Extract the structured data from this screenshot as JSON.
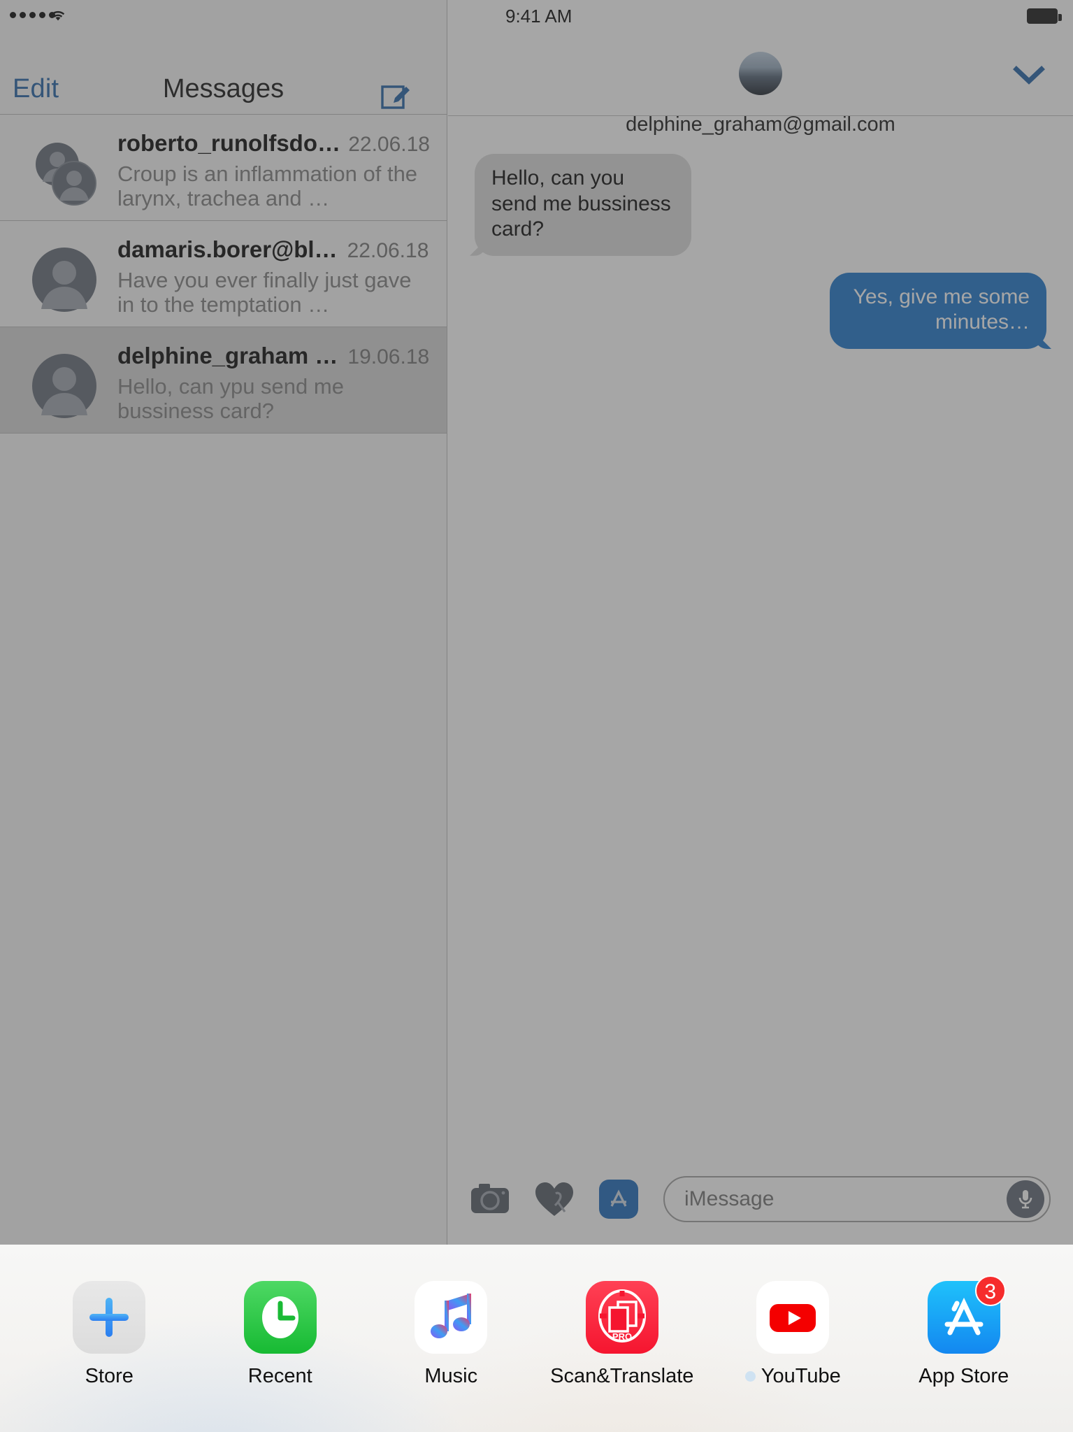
{
  "status_bar_left": {
    "signal_dots": 5,
    "wifi_icon": "wifi-icon"
  },
  "status_bar_right": {
    "time": "9:41 AM",
    "battery_icon": "battery-full-icon"
  },
  "messages_list": {
    "edit_label": "Edit",
    "title": "Messages",
    "compose_icon": "compose-icon",
    "conversations": [
      {
        "name": "roberto_runolfsdo…",
        "date": "22.06.18",
        "preview": "Croup is an inflammation of the larynx, trachea and …",
        "avatar": "group-avatar-icon",
        "selected": false
      },
      {
        "name": "damaris.borer@bl…",
        "date": "22.06.18",
        "preview": "Have you ever finally just gave in to the temptation …",
        "avatar": "person-avatar-icon",
        "selected": false
      },
      {
        "name": "delphine_graham …",
        "date": "19.06.18",
        "preview": "Hello, can ypu send me bussiness card?",
        "avatar": "person-avatar-icon",
        "selected": true
      }
    ]
  },
  "conversation": {
    "contact_email": "delphine_graham@gmail.com",
    "avatar": "contact-photo",
    "details_icon": "chevron-down-icon",
    "messages": [
      {
        "direction": "in",
        "text": "Hello, can you send me bussiness card?"
      },
      {
        "direction": "out",
        "text": "Yes, give me some minutes…"
      }
    ]
  },
  "composer": {
    "camera_icon": "camera-icon",
    "digital_touch_icon": "digital-touch-heart-icon",
    "app_store_icon": "imessage-appstore-icon",
    "input_value": "",
    "input_placeholder": "iMessage",
    "mic_icon": "microphone-icon"
  },
  "dock": {
    "apps": [
      {
        "label": "Store",
        "icon": "plus-icon",
        "badge": null,
        "dot": false
      },
      {
        "label": "Recent",
        "icon": "clock-icon",
        "badge": null,
        "dot": false
      },
      {
        "label": "Music",
        "icon": "music-note-icon",
        "badge": null,
        "dot": false
      },
      {
        "label": "Scan&Translate",
        "icon": "scan-pro-icon",
        "badge": null,
        "dot": false
      },
      {
        "label": "YouTube",
        "icon": "youtube-icon",
        "badge": null,
        "dot": true
      },
      {
        "label": "App Store",
        "icon": "app-store-icon",
        "badge": "3",
        "dot": false
      }
    ]
  },
  "colors": {
    "accent_blue": "#1a5ca3",
    "bubble_out": "#1571c8",
    "bubble_in": "#d8d8d8",
    "badge_red": "#f62c2c"
  }
}
